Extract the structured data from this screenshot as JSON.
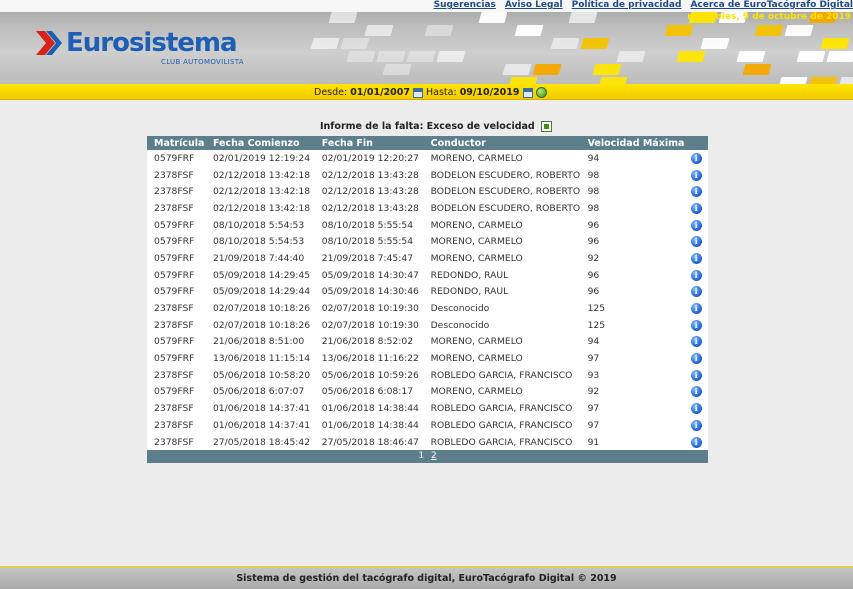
{
  "header": {
    "links": [
      "Sugerencias",
      "Aviso Legal",
      "Política de privacidad",
      "Acerca de EuroTacógrafo Digital"
    ],
    "current_date": "miércoles, 9 de octubre de 2019",
    "logo_text": "Eurosistema",
    "logo_subtitle": "CLUB AUTOMOVILISTA"
  },
  "filter": {
    "from_label": "Desde:",
    "from_value": "01/01/2007",
    "to_label": "Hasta:",
    "to_value": "09/10/2019"
  },
  "report": {
    "title": "Informe de la falta: Exceso de velocidad",
    "columns": [
      "Matrícula",
      "Fecha Comienzo",
      "Fecha Fin",
      "Conductor",
      "Velocidad Máxima"
    ],
    "rows": [
      [
        "0579FRF",
        "02/01/2019 12:19:24",
        "02/01/2019 12:20:27",
        "MORENO, CARMELO",
        "94"
      ],
      [
        "2378FSF",
        "02/12/2018 13:42:18",
        "02/12/2018 13:43:28",
        "BODELON ESCUDERO, ROBERTO",
        "98"
      ],
      [
        "2378FSF",
        "02/12/2018 13:42:18",
        "02/12/2018 13:43:28",
        "BODELON ESCUDERO, ROBERTO",
        "98"
      ],
      [
        "2378FSF",
        "02/12/2018 13:42:18",
        "02/12/2018 13:43:28",
        "BODELON ESCUDERO, ROBERTO",
        "98"
      ],
      [
        "0579FRF",
        "08/10/2018 5:54:53",
        "08/10/2018 5:55:54",
        "MORENO, CARMELO",
        "96"
      ],
      [
        "0579FRF",
        "08/10/2018 5:54:53",
        "08/10/2018 5:55:54",
        "MORENO, CARMELO",
        "96"
      ],
      [
        "0579FRF",
        "21/09/2018 7:44:40",
        "21/09/2018 7:45:47",
        "MORENO, CARMELO",
        "92"
      ],
      [
        "0579FRF",
        "05/09/2018 14:29:45",
        "05/09/2018 14:30:47",
        "REDONDO, RAUL",
        "96"
      ],
      [
        "0579FRF",
        "05/09/2018 14:29:44",
        "05/09/2018 14:30:46",
        "REDONDO, RAUL",
        "96"
      ],
      [
        "2378FSF",
        "02/07/2018 10:18:26",
        "02/07/2018 10:19:30",
        "Desconocido",
        "125"
      ],
      [
        "2378FSF",
        "02/07/2018 10:18:26",
        "02/07/2018 10:19:30",
        "Desconocido",
        "125"
      ],
      [
        "0579FRF",
        "21/06/2018 8:51:00",
        "21/06/2018 8:52:02",
        "MORENO, CARMELO",
        "94"
      ],
      [
        "0579FRF",
        "13/06/2018 11:15:14",
        "13/06/2018 11:16:22",
        "MORENO, CARMELO",
        "97"
      ],
      [
        "2378FSF",
        "05/06/2018 10:58:20",
        "05/06/2018 10:59:26",
        "ROBLEDO GARCIA, FRANCISCO",
        "93"
      ],
      [
        "0579FRF",
        "05/06/2018 6:07:07",
        "05/06/2018 6:08:17",
        "MORENO, CARMELO",
        "92"
      ],
      [
        "2378FSF",
        "01/06/2018 14:37:41",
        "01/06/2018 14:38:44",
        "ROBLEDO GARCIA, FRANCISCO",
        "97"
      ],
      [
        "2378FSF",
        "01/06/2018 14:37:41",
        "01/06/2018 14:38:44",
        "ROBLEDO GARCIA, FRANCISCO",
        "97"
      ],
      [
        "2378FSF",
        "27/05/2018 18:45:42",
        "27/05/2018 18:46:47",
        "ROBLEDO GARCIA, FRANCISCO",
        "91"
      ]
    ],
    "pages": [
      "1",
      "2"
    ],
    "current_page": "1"
  },
  "footer": {
    "text": "Sistema de gestión del tacógrafo digital, EuroTacógrafo Digital © 2019"
  },
  "colors": {
    "brand_blue": "#1d5fb4",
    "accent_yellow": "#ffe600",
    "table_header": "#5d7f8c"
  }
}
